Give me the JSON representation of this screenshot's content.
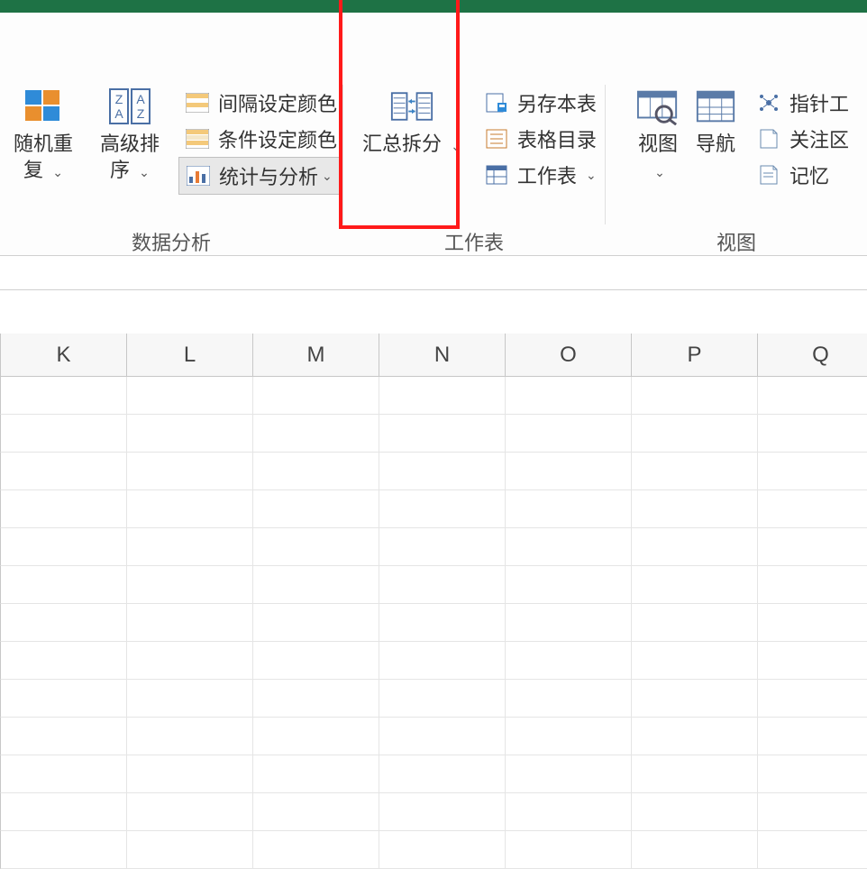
{
  "ribbon": {
    "group_data_analysis": {
      "label": "数据分析",
      "random_repeat": "随机重复",
      "advanced_sort": "高级排序",
      "interval_color": "间隔设定颜色",
      "conditional_color": "条件设定颜色",
      "stats_analysis": "统计与分析"
    },
    "group_worksheet": {
      "label": "工作表",
      "summary_split": "汇总拆分",
      "save_as_sheet": "另存本表",
      "sheet_toc": "表格目录",
      "worksheet_menu": "工作表"
    },
    "group_view": {
      "label": "视图",
      "view_btn": "视图",
      "nav_btn": "导航",
      "pointer_tool": "指针工",
      "watch_region": "关注区",
      "memory": "记忆"
    },
    "dropdown_glyph": "⌄"
  },
  "columns": [
    "K",
    "L",
    "M",
    "N",
    "O",
    "P",
    "Q"
  ],
  "row_count": 13
}
